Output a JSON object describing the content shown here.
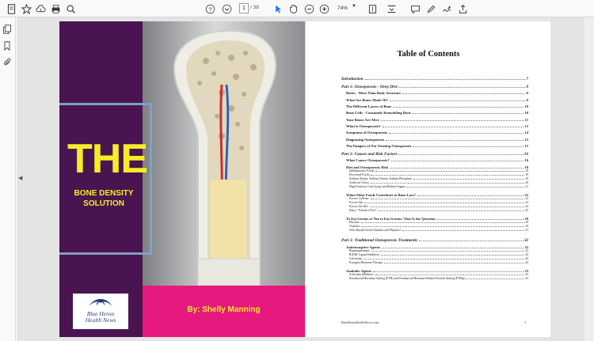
{
  "toolbar": {
    "current_page": "1",
    "page_count": "/ 38",
    "zoom": "74%"
  },
  "cover": {
    "title": "THE",
    "subtitle_line1": "BONE DENSITY",
    "subtitle_line2": "SOLUTION",
    "author": "By: Shelly Manning",
    "logo_line1": "Blue Heron",
    "logo_line2": "Health News",
    "colors": {
      "background": "#4a1450",
      "title": "#f7ec27",
      "author_band": "#e6197e",
      "frame": "#7fa0c7"
    }
  },
  "toc": {
    "heading": "Table of Contents",
    "entries": [
      {
        "level": 1,
        "title": "Introduction",
        "page": "7"
      },
      {
        "level": 1,
        "title": "Part 1:  Osteoporosis - Deep Dive",
        "page": "9"
      },
      {
        "level": 2,
        "title": "Bones - More Than Body Structure",
        "page": "9"
      },
      {
        "level": 2,
        "title": "What Are Bones Made Of?",
        "page": "9"
      },
      {
        "level": 2,
        "title": "The Different Layers of Bone",
        "page": "10"
      },
      {
        "level": 2,
        "title": "Bone Cells - Constantly Remodeling Bone",
        "page": "10"
      },
      {
        "level": 2,
        "title": "Your Bones Are Alive",
        "page": "11"
      },
      {
        "level": 2,
        "title": "What is Osteoporosis?",
        "page": "12"
      },
      {
        "level": 2,
        "title": "Symptoms of Osteoporosis",
        "page": "14"
      },
      {
        "level": 2,
        "title": "Diagnosing Osteoporosis",
        "page": "15"
      },
      {
        "level": 2,
        "title": "The Dangers of Not Treating Osteoporosis",
        "page": "15"
      },
      {
        "level": 1,
        "title": "Part 2:  Causes and Risk Factors",
        "page": "16"
      },
      {
        "level": 2,
        "title": "What Causes Osteoporosis?",
        "page": "16"
      },
      {
        "level": 2,
        "title": "Diet and Osteoporosis Risk",
        "page": "18"
      },
      {
        "level": 3,
        "title": "Inflammatory Foods",
        "page": "18"
      },
      {
        "level": 3,
        "title": "Processed Foods",
        "page": "19"
      },
      {
        "level": 3,
        "title": "Sodium Nitrate, Sodium Nitrate, Sodium Phosphate",
        "page": "19"
      },
      {
        "level": 3,
        "title": "Artificial Colors",
        "page": "20"
      },
      {
        "level": 3,
        "title": "High Fructose Corn Syrup and Refined Sugars",
        "page": "21"
      },
      {
        "level": 2,
        "title": "What Other Foods Contribute to Bone Loss?",
        "page": "22"
      },
      {
        "level": 3,
        "title": "Excess Caffeine",
        "page": "22"
      },
      {
        "level": 3,
        "title": "Excess Salt",
        "page": "23"
      },
      {
        "level": 3,
        "title": "Excess Alcohol",
        "page": "24"
      },
      {
        "level": 3,
        "title": "Dairy - Friend or Foe?",
        "page": "25"
      },
      {
        "level": 2,
        "title": "To Eat Greens or Not to Eat Greens: That Is the Question",
        "page": "29"
      },
      {
        "level": 3,
        "title": "Phytates",
        "page": "29"
      },
      {
        "level": 3,
        "title": "Oxalates",
        "page": "29"
      },
      {
        "level": 3,
        "title": "Who Should Avoid Oxalates and Phytates?",
        "page": "31"
      },
      {
        "level": 1,
        "title": "Part 3:  Traditional Osteoporosis Treatments",
        "page": "32"
      },
      {
        "level": 2,
        "title": "Antiresorptive Agents",
        "page": "32"
      },
      {
        "level": 3,
        "title": "Bisphosphonates",
        "page": "32"
      },
      {
        "level": 3,
        "title": "RANK Ligand Inhibitors",
        "page": "32"
      },
      {
        "level": 3,
        "title": "Calcitonin",
        "page": "32"
      },
      {
        "level": 3,
        "title": "Estrogen Hormone Therapy",
        "page": "32"
      },
      {
        "level": 2,
        "title": "Anabolic Agents",
        "page": "33"
      },
      {
        "level": 3,
        "title": "Sclerostin Inhibitors",
        "page": "33"
      },
      {
        "level": 3,
        "title": "Parathyroid Hormone Analog (PTH) and Parathyroid Hormone-Related Protein Analog (PTHrp)",
        "page": "34"
      }
    ],
    "footer_site": "BlueHeronHealthNews.com",
    "footer_page": "5"
  }
}
